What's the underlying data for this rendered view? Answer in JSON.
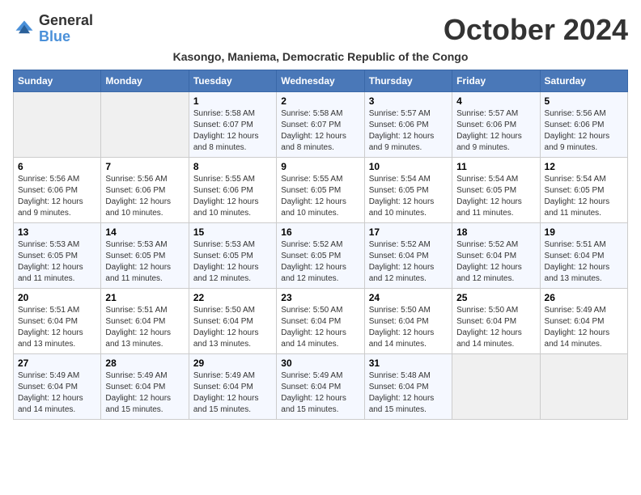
{
  "header": {
    "logo_general": "General",
    "logo_blue": "Blue",
    "month_title": "October 2024",
    "subtitle": "Kasongo, Maniema, Democratic Republic of the Congo"
  },
  "calendar": {
    "days_of_week": [
      "Sunday",
      "Monday",
      "Tuesday",
      "Wednesday",
      "Thursday",
      "Friday",
      "Saturday"
    ],
    "weeks": [
      [
        {
          "day": "",
          "sunrise": "",
          "sunset": "",
          "daylight": ""
        },
        {
          "day": "",
          "sunrise": "",
          "sunset": "",
          "daylight": ""
        },
        {
          "day": "1",
          "sunrise": "Sunrise: 5:58 AM",
          "sunset": "Sunset: 6:07 PM",
          "daylight": "Daylight: 12 hours and 8 minutes."
        },
        {
          "day": "2",
          "sunrise": "Sunrise: 5:58 AM",
          "sunset": "Sunset: 6:07 PM",
          "daylight": "Daylight: 12 hours and 8 minutes."
        },
        {
          "day": "3",
          "sunrise": "Sunrise: 5:57 AM",
          "sunset": "Sunset: 6:06 PM",
          "daylight": "Daylight: 12 hours and 9 minutes."
        },
        {
          "day": "4",
          "sunrise": "Sunrise: 5:57 AM",
          "sunset": "Sunset: 6:06 PM",
          "daylight": "Daylight: 12 hours and 9 minutes."
        },
        {
          "day": "5",
          "sunrise": "Sunrise: 5:56 AM",
          "sunset": "Sunset: 6:06 PM",
          "daylight": "Daylight: 12 hours and 9 minutes."
        }
      ],
      [
        {
          "day": "6",
          "sunrise": "Sunrise: 5:56 AM",
          "sunset": "Sunset: 6:06 PM",
          "daylight": "Daylight: 12 hours and 9 minutes."
        },
        {
          "day": "7",
          "sunrise": "Sunrise: 5:56 AM",
          "sunset": "Sunset: 6:06 PM",
          "daylight": "Daylight: 12 hours and 10 minutes."
        },
        {
          "day": "8",
          "sunrise": "Sunrise: 5:55 AM",
          "sunset": "Sunset: 6:06 PM",
          "daylight": "Daylight: 12 hours and 10 minutes."
        },
        {
          "day": "9",
          "sunrise": "Sunrise: 5:55 AM",
          "sunset": "Sunset: 6:05 PM",
          "daylight": "Daylight: 12 hours and 10 minutes."
        },
        {
          "day": "10",
          "sunrise": "Sunrise: 5:54 AM",
          "sunset": "Sunset: 6:05 PM",
          "daylight": "Daylight: 12 hours and 10 minutes."
        },
        {
          "day": "11",
          "sunrise": "Sunrise: 5:54 AM",
          "sunset": "Sunset: 6:05 PM",
          "daylight": "Daylight: 12 hours and 11 minutes."
        },
        {
          "day": "12",
          "sunrise": "Sunrise: 5:54 AM",
          "sunset": "Sunset: 6:05 PM",
          "daylight": "Daylight: 12 hours and 11 minutes."
        }
      ],
      [
        {
          "day": "13",
          "sunrise": "Sunrise: 5:53 AM",
          "sunset": "Sunset: 6:05 PM",
          "daylight": "Daylight: 12 hours and 11 minutes."
        },
        {
          "day": "14",
          "sunrise": "Sunrise: 5:53 AM",
          "sunset": "Sunset: 6:05 PM",
          "daylight": "Daylight: 12 hours and 11 minutes."
        },
        {
          "day": "15",
          "sunrise": "Sunrise: 5:53 AM",
          "sunset": "Sunset: 6:05 PM",
          "daylight": "Daylight: 12 hours and 12 minutes."
        },
        {
          "day": "16",
          "sunrise": "Sunrise: 5:52 AM",
          "sunset": "Sunset: 6:05 PM",
          "daylight": "Daylight: 12 hours and 12 minutes."
        },
        {
          "day": "17",
          "sunrise": "Sunrise: 5:52 AM",
          "sunset": "Sunset: 6:04 PM",
          "daylight": "Daylight: 12 hours and 12 minutes."
        },
        {
          "day": "18",
          "sunrise": "Sunrise: 5:52 AM",
          "sunset": "Sunset: 6:04 PM",
          "daylight": "Daylight: 12 hours and 12 minutes."
        },
        {
          "day": "19",
          "sunrise": "Sunrise: 5:51 AM",
          "sunset": "Sunset: 6:04 PM",
          "daylight": "Daylight: 12 hours and 13 minutes."
        }
      ],
      [
        {
          "day": "20",
          "sunrise": "Sunrise: 5:51 AM",
          "sunset": "Sunset: 6:04 PM",
          "daylight": "Daylight: 12 hours and 13 minutes."
        },
        {
          "day": "21",
          "sunrise": "Sunrise: 5:51 AM",
          "sunset": "Sunset: 6:04 PM",
          "daylight": "Daylight: 12 hours and 13 minutes."
        },
        {
          "day": "22",
          "sunrise": "Sunrise: 5:50 AM",
          "sunset": "Sunset: 6:04 PM",
          "daylight": "Daylight: 12 hours and 13 minutes."
        },
        {
          "day": "23",
          "sunrise": "Sunrise: 5:50 AM",
          "sunset": "Sunset: 6:04 PM",
          "daylight": "Daylight: 12 hours and 14 minutes."
        },
        {
          "day": "24",
          "sunrise": "Sunrise: 5:50 AM",
          "sunset": "Sunset: 6:04 PM",
          "daylight": "Daylight: 12 hours and 14 minutes."
        },
        {
          "day": "25",
          "sunrise": "Sunrise: 5:50 AM",
          "sunset": "Sunset: 6:04 PM",
          "daylight": "Daylight: 12 hours and 14 minutes."
        },
        {
          "day": "26",
          "sunrise": "Sunrise: 5:49 AM",
          "sunset": "Sunset: 6:04 PM",
          "daylight": "Daylight: 12 hours and 14 minutes."
        }
      ],
      [
        {
          "day": "27",
          "sunrise": "Sunrise: 5:49 AM",
          "sunset": "Sunset: 6:04 PM",
          "daylight": "Daylight: 12 hours and 14 minutes."
        },
        {
          "day": "28",
          "sunrise": "Sunrise: 5:49 AM",
          "sunset": "Sunset: 6:04 PM",
          "daylight": "Daylight: 12 hours and 15 minutes."
        },
        {
          "day": "29",
          "sunrise": "Sunrise: 5:49 AM",
          "sunset": "Sunset: 6:04 PM",
          "daylight": "Daylight: 12 hours and 15 minutes."
        },
        {
          "day": "30",
          "sunrise": "Sunrise: 5:49 AM",
          "sunset": "Sunset: 6:04 PM",
          "daylight": "Daylight: 12 hours and 15 minutes."
        },
        {
          "day": "31",
          "sunrise": "Sunrise: 5:48 AM",
          "sunset": "Sunset: 6:04 PM",
          "daylight": "Daylight: 12 hours and 15 minutes."
        },
        {
          "day": "",
          "sunrise": "",
          "sunset": "",
          "daylight": ""
        },
        {
          "day": "",
          "sunrise": "",
          "sunset": "",
          "daylight": ""
        }
      ]
    ]
  }
}
